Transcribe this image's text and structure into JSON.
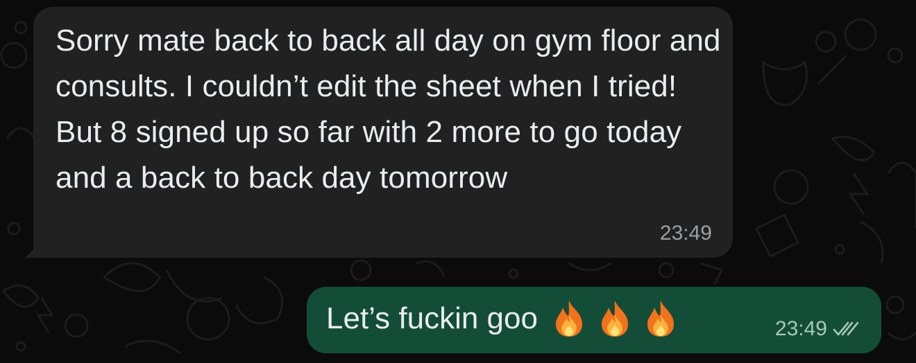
{
  "conversation": {
    "incoming_message": {
      "text": "Sorry mate back to back all day on gym floor and consults. I couldn’t edit the sheet when I tried! But 8 signed up so far with 2 more to go today and a back to back day tomorrow",
      "time": "23:49"
    },
    "outgoing_message": {
      "text": "Let’s fuckin goo",
      "emoji_icons": [
        "fire-icon",
        "fire-icon",
        "fire-icon"
      ],
      "time": "23:49",
      "status_icon": "double-check-icon"
    }
  },
  "colors": {
    "background": "#0b0b0b",
    "incoming_bubble": "#212121",
    "outgoing_bubble": "#144d37",
    "text": "#e9edef",
    "incoming_time": "#9aa0a3",
    "outgoing_time": "#a6c9b8"
  }
}
